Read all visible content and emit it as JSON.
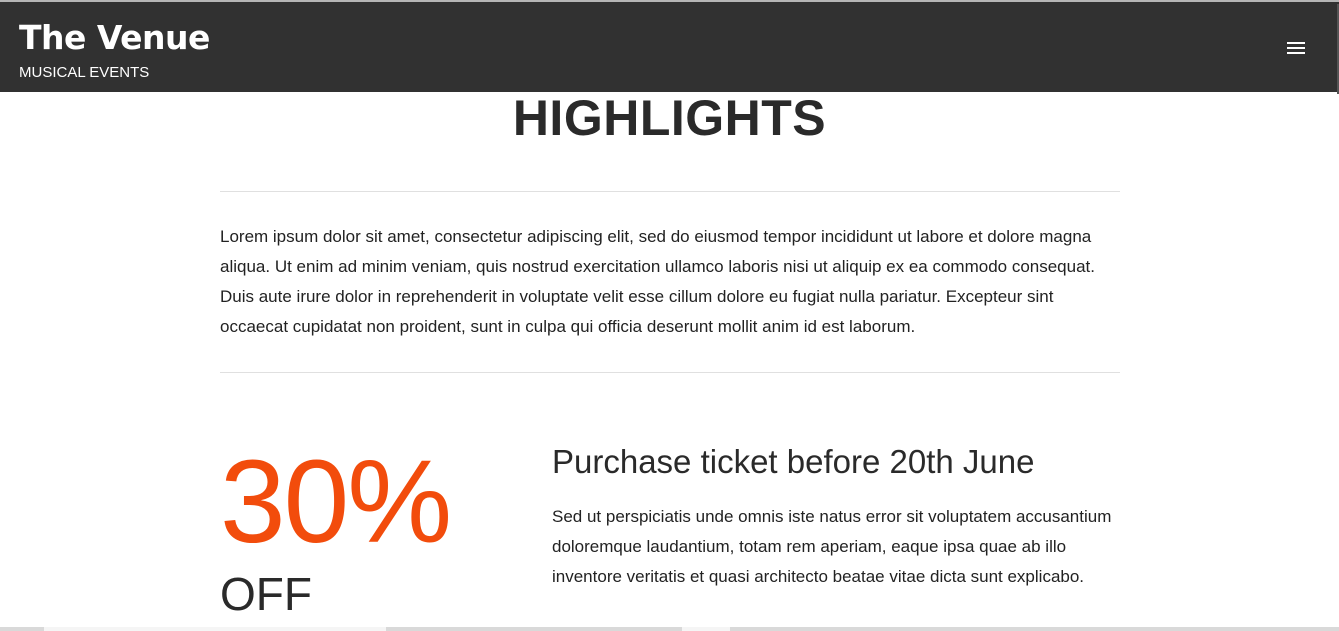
{
  "header": {
    "brand_title": "The Venue",
    "brand_subtitle": "MUSICAL EVENTS",
    "menu_icon": "hamburger-menu-icon",
    "background": "#313131"
  },
  "highlights": {
    "title": "HIGHLIGHTS",
    "intro": "Lorem ipsum dolor sit amet, consectetur adipiscing elit, sed do eiusmod tempor incididunt ut labore et dolore magna aliqua. Ut enim ad minim veniam, quis nostrud exercitation ullamco laboris nisi ut aliquip ex ea commodo consequat. Duis aute irure dolor in reprehenderit in voluptate velit esse cillum dolore eu fugiat nulla pariatur. Excepteur sint occaecat cupidatat non proident, sunt in culpa qui officia deserunt mollit anim id est laborum."
  },
  "promo": {
    "discount": "30%",
    "off_label": "OFF",
    "title": "Purchase ticket before 20th June",
    "text": "Sed ut perspiciatis unde omnis iste natus error sit voluptatem accusantium doloremque laudantium, totam rem aperiam, eaque ipsa quae ab illo inventore veritatis et quasi architecto beatae vitae dicta sunt explicabo.",
    "accent_color": "#f24c0c"
  }
}
